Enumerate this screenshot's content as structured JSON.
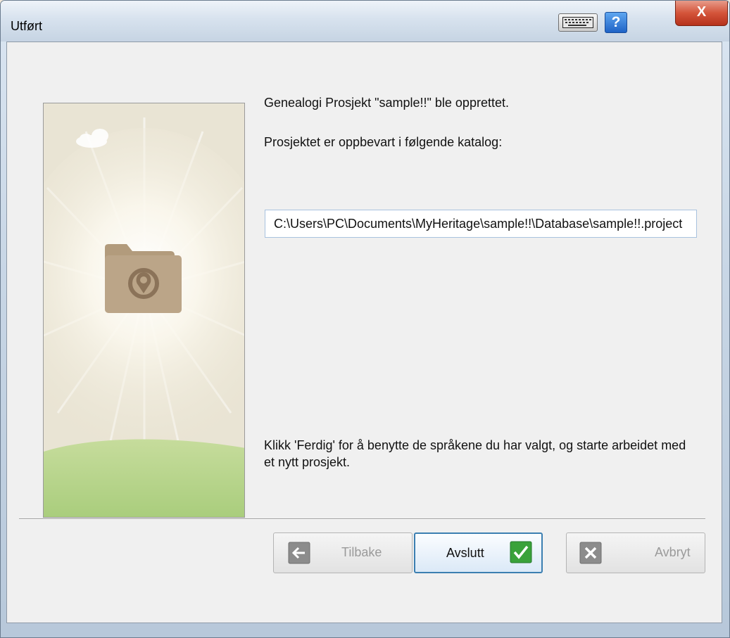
{
  "window": {
    "title": "Utført",
    "help_label": "?",
    "close_label": "X"
  },
  "message": {
    "created": "Genealogi Prosjekt \"sample!!\" ble opprettet.",
    "stored_in": "Prosjektet er oppbevart i følgende katalog:",
    "path_value": "C:\\Users\\PC\\Documents\\MyHeritage\\sample!!\\Database\\sample!!.project",
    "finish_hint": "Klikk 'Ferdig' for å benytte de språkene du har valgt, og starte arbeidet med et nytt prosjekt."
  },
  "buttons": {
    "back_label": "Tilbake",
    "finish_label": "Avslutt",
    "cancel_label": "Avbryt"
  },
  "icons": {
    "keyboard": "keyboard-icon",
    "help": "help-icon",
    "close": "close-icon",
    "folder": "folder-icon",
    "back_arrow": "arrow-left-icon",
    "checkmark": "checkmark-icon",
    "cancel_x": "x-icon"
  },
  "colors": {
    "close_button": "#c9442a",
    "help_button": "#2f78d8",
    "finish_border": "#3c7fb1",
    "checkmark_green": "#3aa23a"
  }
}
